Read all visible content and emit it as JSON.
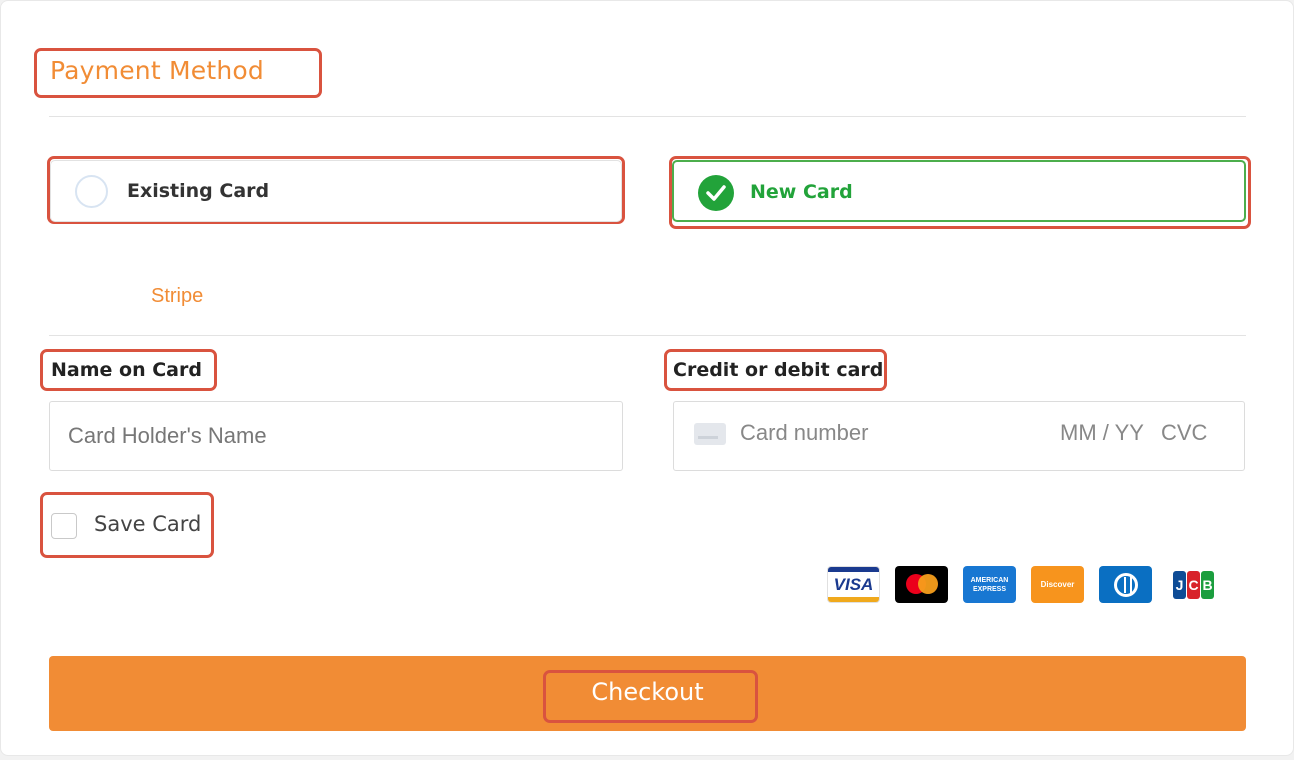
{
  "payment": {
    "title": "Payment Method",
    "options": [
      {
        "label": "Existing Card",
        "selected": false
      },
      {
        "label": "New Card",
        "selected": true
      }
    ],
    "provider_tab": "Stripe"
  },
  "form": {
    "name_label": "Name on Card",
    "name_placeholder": "Card Holder's Name",
    "card_label": "Credit or debit card",
    "card_number_placeholder": "Card number",
    "expiry_placeholder": "MM / YY",
    "cvc_placeholder": "CVC",
    "save_card_label": "Save Card",
    "save_card_checked": false
  },
  "brands": {
    "visa": "VISA",
    "amex_line1": "AMERICAN",
    "amex_line2": "EXPRESS",
    "discover": "Discover",
    "jcb": [
      "J",
      "C",
      "B"
    ]
  },
  "checkout": {
    "label": "Checkout"
  },
  "colors": {
    "accent_orange": "#f18c35",
    "success_green": "#22a33a",
    "highlight_red": "#d9533f"
  }
}
